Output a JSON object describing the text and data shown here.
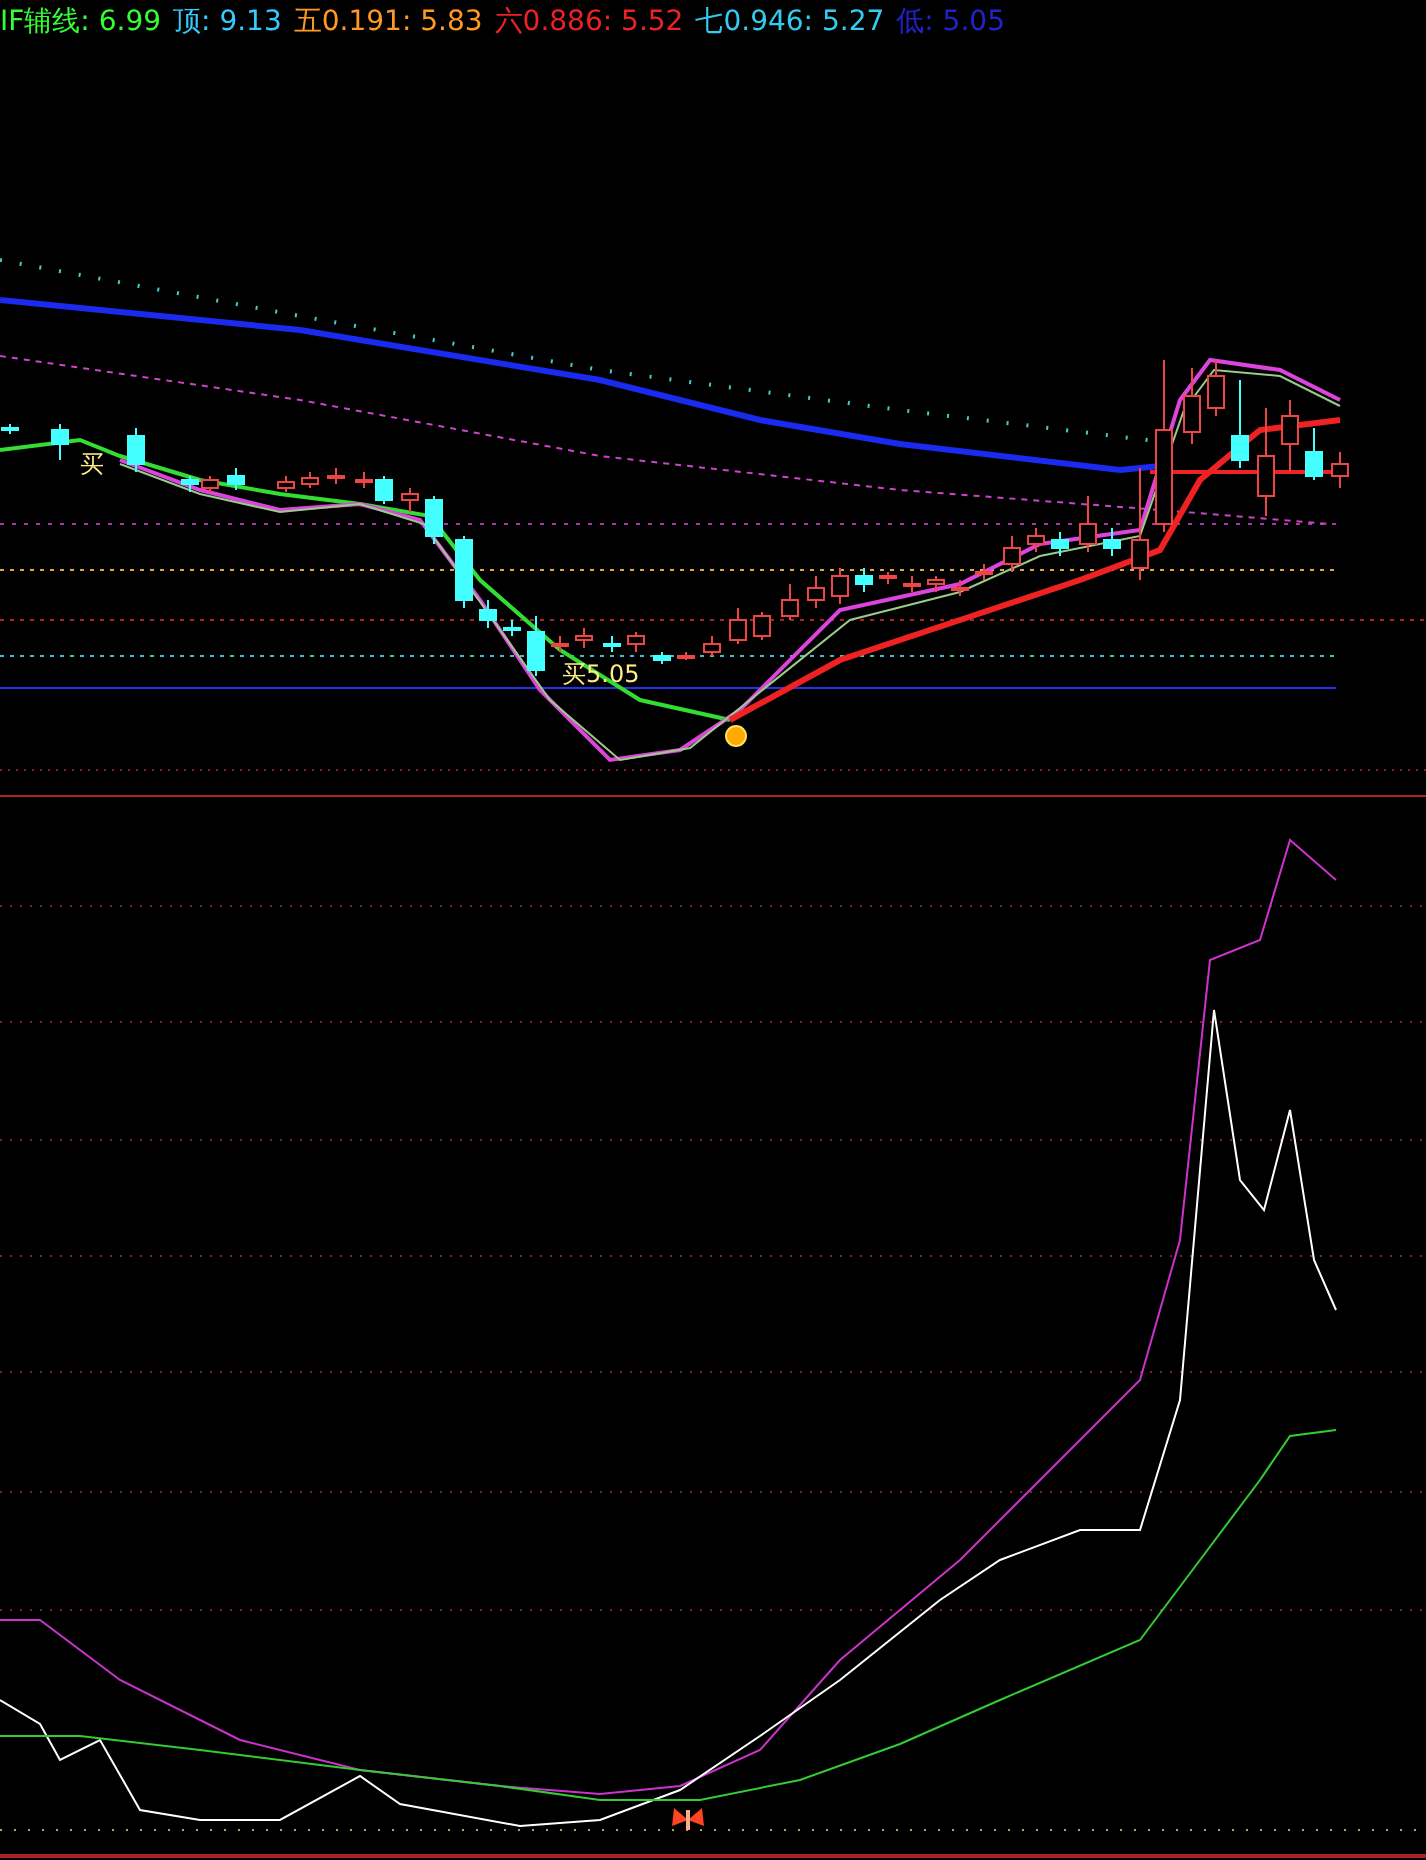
{
  "legend": [
    {
      "label": "IF辅线:",
      "value": "6.99",
      "color": "#33ff33"
    },
    {
      "label": "顶:",
      "value": "9.13",
      "color": "#33ccff"
    },
    {
      "label": "五0.191:",
      "value": "5.83",
      "color": "#ff9922"
    },
    {
      "label": "六0.886:",
      "value": "5.52",
      "color": "#ee2222"
    },
    {
      "label": "七0.946:",
      "value": "5.27",
      "color": "#33ccee"
    },
    {
      "label": "低:",
      "value": "5.05",
      "color": "#2222cc"
    }
  ],
  "price_chart": {
    "signals": [
      {
        "text": "买"
      },
      {
        "text": "买5.05"
      }
    ]
  }
}
